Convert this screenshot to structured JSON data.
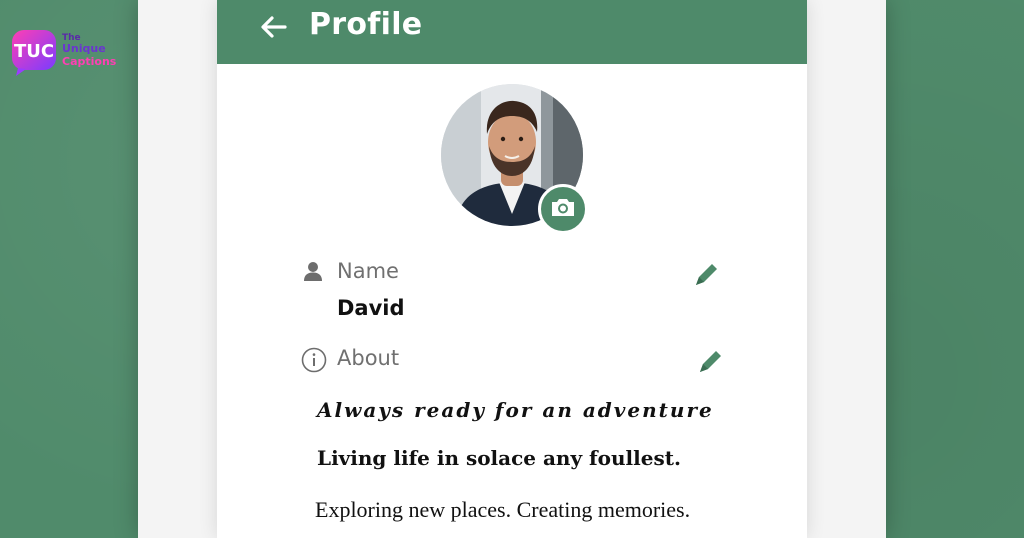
{
  "header": {
    "title": "Profile"
  },
  "logo": {
    "monogram": "TUC",
    "line1": "The",
    "line2": "Unique",
    "line3": "Captions"
  },
  "profile": {
    "name_label": "Name",
    "name_value": "David",
    "about_label": "About",
    "about_lines": [
      "Always ready for an adventure",
      "Living life in solace any foullest.",
      "Exploring new places. Creating memories."
    ]
  },
  "colors": {
    "accent": "#4e8a6a",
    "background": "#508b6b",
    "label_gray": "#707070"
  },
  "icons": [
    "back-arrow-icon",
    "camera-icon",
    "person-icon",
    "pencil-icon",
    "info-icon"
  ]
}
